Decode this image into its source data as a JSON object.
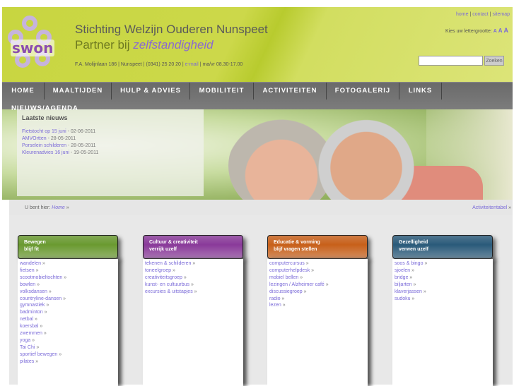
{
  "header": {
    "logo_text": "swon",
    "title": "Stichting Welzijn Ouderen Nunspeet",
    "subtitle_prefix": "Partner bij",
    "subtitle_em": "zelfstandigheid",
    "address": "F.A. Molijnlaan 186 | Nunspeet | (0341) 25 20 20 |",
    "email": "e-mail",
    "hours": "| ma/vr 08.30-17.00",
    "toplinks": [
      "home",
      "contact",
      "sitemap"
    ],
    "fontsize_label": "Kies uw lettergrootte:",
    "fontsize_options": [
      "A",
      "A",
      "A"
    ],
    "search_placeholder": "",
    "search_button": "Zoeken"
  },
  "nav": [
    "HOME",
    "MAALTIJDEN",
    "HULP & ADVIES",
    "MOBILITEIT",
    "ACTIVITEITEN",
    "FOTOGALERIJ",
    "LINKS",
    "NIEUWS/AGENDA"
  ],
  "news": {
    "title": "Laatste nieuws",
    "items": [
      {
        "link": "Fietstocht op 15 juni",
        "date": " - 02-06-2011"
      },
      {
        "link": "AMVOrtten",
        "date": " - 28-05-2011"
      },
      {
        "link": "Porselein schilderen",
        "date": " - 28-05-2011"
      },
      {
        "link": "Kleurenadvies 16 juni",
        "date": " - 19-05-2011"
      }
    ]
  },
  "breadcrumb": {
    "label": "U bent hier:",
    "home": "Home",
    "arrow": "»",
    "right_link": "Activiteitentabel"
  },
  "columns": [
    {
      "title": "Bewegen",
      "subtitle": "blijf fit",
      "color": "#6a9a30",
      "items": [
        "wandelen",
        "fietsen",
        "scootmobieltochten",
        "bowlen",
        "volksdansen",
        "countryline-dansen",
        "gymnastiek",
        "badminton",
        "netbal",
        "koersbal",
        "zwemmen",
        "yoga",
        "Tai Chi",
        "sportief bewegen",
        "pilates"
      ]
    },
    {
      "title": "Cultuur & creativiteit",
      "subtitle": "verrijk uzelf",
      "color": "#8a3a9a",
      "items": [
        "tekenen & schilderen",
        "toneelgroep",
        "creativiteitsgroep",
        "kunst- en cultuurbus",
        "excursies & uitstapjes"
      ]
    },
    {
      "title": "Educatie & vorming",
      "subtitle": "blijf vragen stellen",
      "color": "#c8601a",
      "items": [
        "computercursus",
        "computerhelpdesk",
        "mobiel bellen",
        "lezingen / Alzheimer café",
        "discussiegroep",
        "radio",
        "lezen"
      ]
    },
    {
      "title": "Gezelligheid",
      "subtitle": "verwen uzelf",
      "color": "#2a5a7a",
      "items": [
        "soos & bingo",
        "sjoelen",
        "bridge",
        "biljarten",
        "klaverjassen",
        "sudoku"
      ]
    }
  ]
}
